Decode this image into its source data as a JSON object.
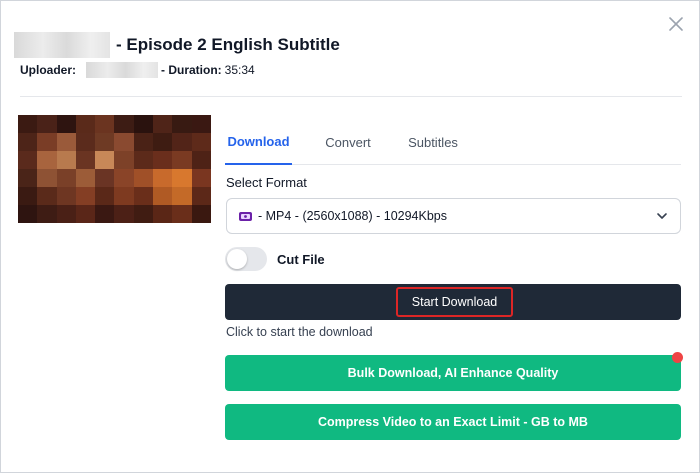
{
  "header": {
    "title": "- Episode 2 English Subtitle",
    "uploader_label": "Uploader:",
    "duration_label": "- Duration:",
    "duration_value": "35:34"
  },
  "icons": {
    "close": "close-icon",
    "format": "film-icon",
    "dropdown": "chevron-down-icon"
  },
  "tabs": [
    {
      "label": "Download",
      "active": true
    },
    {
      "label": "Convert",
      "active": false
    },
    {
      "label": "Subtitles",
      "active": false
    }
  ],
  "format": {
    "label": "Select Format",
    "selected": "- MP4 - (2560x1088) - 10294Kbps"
  },
  "cut_file": {
    "label": "Cut File",
    "enabled": false
  },
  "actions": {
    "start_download": "Start Download",
    "hint": "Click to start the download",
    "bulk_download": "Bulk Download, AI Enhance Quality",
    "compress": "Compress Video to an Exact Limit - GB to MB"
  },
  "colors": {
    "accent_blue": "#2563eb",
    "primary_dark": "#1f2937",
    "green": "#10b981",
    "highlight_red": "#dc2626",
    "notification_red": "#ef4444"
  }
}
